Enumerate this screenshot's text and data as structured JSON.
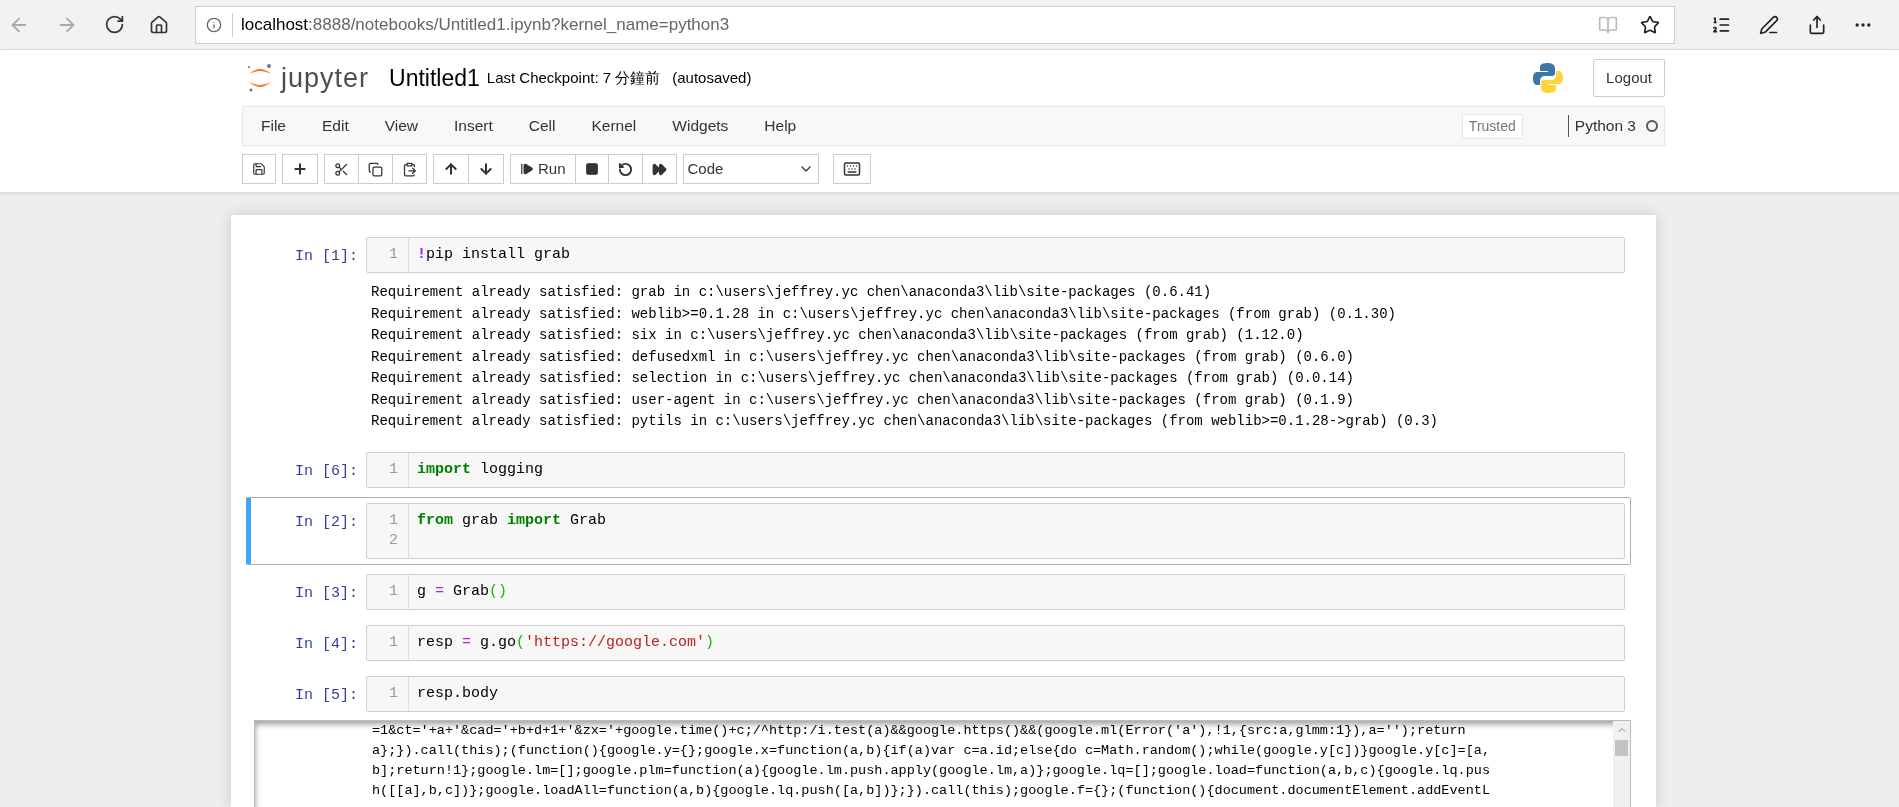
{
  "browser": {
    "url_host": "localhost",
    "url_rest": ":8888/notebooks/Untitled1.ipynb?kernel_name=python3"
  },
  "header": {
    "logo_text": "jupyter",
    "notebook_name": "Untitled1",
    "checkpoint": "Last Checkpoint: 7 分鐘前",
    "autosave": "(autosaved)",
    "logout": "Logout"
  },
  "menu": {
    "items": [
      "File",
      "Edit",
      "View",
      "Insert",
      "Cell",
      "Kernel",
      "Widgets",
      "Help"
    ],
    "trusted": "Trusted",
    "kernel": "Python 3",
    "kernel_busy": false
  },
  "toolbar": {
    "run_label": "Run",
    "cell_type": "Code"
  },
  "cells": [
    {
      "prompt": "In [1]:",
      "selected": false,
      "line_numbers": [
        "1"
      ],
      "lines": [
        [
          {
            "kind": "magic",
            "text": "!"
          },
          {
            "kind": "plain",
            "text": "pip install grab"
          }
        ]
      ],
      "output": {
        "kind": "stream",
        "lines": [
          "Requirement already satisfied: grab in c:\\users\\jeffrey.yc chen\\anaconda3\\lib\\site-packages (0.6.41)",
          "Requirement already satisfied: weblib>=0.1.28 in c:\\users\\jeffrey.yc chen\\anaconda3\\lib\\site-packages (from grab) (0.1.30)",
          "Requirement already satisfied: six in c:\\users\\jeffrey.yc chen\\anaconda3\\lib\\site-packages (from grab) (1.12.0)",
          "Requirement already satisfied: defusedxml in c:\\users\\jeffrey.yc chen\\anaconda3\\lib\\site-packages (from grab) (0.6.0)",
          "Requirement already satisfied: selection in c:\\users\\jeffrey.yc chen\\anaconda3\\lib\\site-packages (from grab) (0.0.14)",
          "Requirement already satisfied: user-agent in c:\\users\\jeffrey.yc chen\\anaconda3\\lib\\site-packages (from grab) (0.1.9)",
          "Requirement already satisfied: pytils in c:\\users\\jeffrey.yc chen\\anaconda3\\lib\\site-packages (from weblib>=0.1.28->grab) (0.3)"
        ]
      }
    },
    {
      "prompt": "In [6]:",
      "selected": false,
      "line_numbers": [
        "1"
      ],
      "lines": [
        [
          {
            "kind": "keyword",
            "text": "import"
          },
          {
            "kind": "plain",
            "text": " logging"
          }
        ]
      ]
    },
    {
      "prompt": "In [2]:",
      "selected": true,
      "line_numbers": [
        "1",
        "2"
      ],
      "lines": [
        [
          {
            "kind": "keyword",
            "text": "from"
          },
          {
            "kind": "plain",
            "text": " grab "
          },
          {
            "kind": "keyword",
            "text": "import"
          },
          {
            "kind": "plain",
            "text": " Grab"
          }
        ]
      ]
    },
    {
      "prompt": "In [3]:",
      "selected": false,
      "line_numbers": [
        "1"
      ],
      "lines": [
        [
          {
            "kind": "plain",
            "text": "g "
          },
          {
            "kind": "operator",
            "text": "="
          },
          {
            "kind": "plain",
            "text": " Grab"
          },
          {
            "kind": "bracket",
            "text": "()"
          }
        ]
      ]
    },
    {
      "prompt": "In [4]:",
      "selected": false,
      "line_numbers": [
        "1"
      ],
      "lines": [
        [
          {
            "kind": "plain",
            "text": "resp "
          },
          {
            "kind": "operator",
            "text": "="
          },
          {
            "kind": "plain",
            "text": " g.go"
          },
          {
            "kind": "bracket",
            "text": "("
          },
          {
            "kind": "string",
            "text": "'https://google.com'"
          },
          {
            "kind": "bracket",
            "text": ")"
          }
        ]
      ]
    },
    {
      "prompt": "In [5]:",
      "selected": false,
      "line_numbers": [
        "1"
      ],
      "lines": [
        [
          {
            "kind": "plain",
            "text": "resp.body"
          }
        ]
      ],
      "output": {
        "kind": "scroll",
        "lines": [
          "=1&ct='+a+'&cad='+b+d+1+'&zx='+google.time()+c;/^http:/i.test(a)&&google.https()&&(google.ml(Error('a'),!1,{src:a,glmm:1}),a='');return",
          "a};}).call(this);(function(){google.y={};google.x=function(a,b){if(a)var c=a.id;else{do c=Math.random();while(google.y[c])}google.y[c]=[a,",
          "b];return!1};google.lm=[];google.plm=function(a){google.lm.push.apply(google.lm,a)};google.lq=[];google.load=function(a,b,c){google.lq.pus",
          "h([[a],b,c])};google.loadAll=function(a,b){google.lq.push([a,b])};}).call(this);google.f={};(function(){document.documentElement.addEventL"
        ]
      }
    }
  ]
}
